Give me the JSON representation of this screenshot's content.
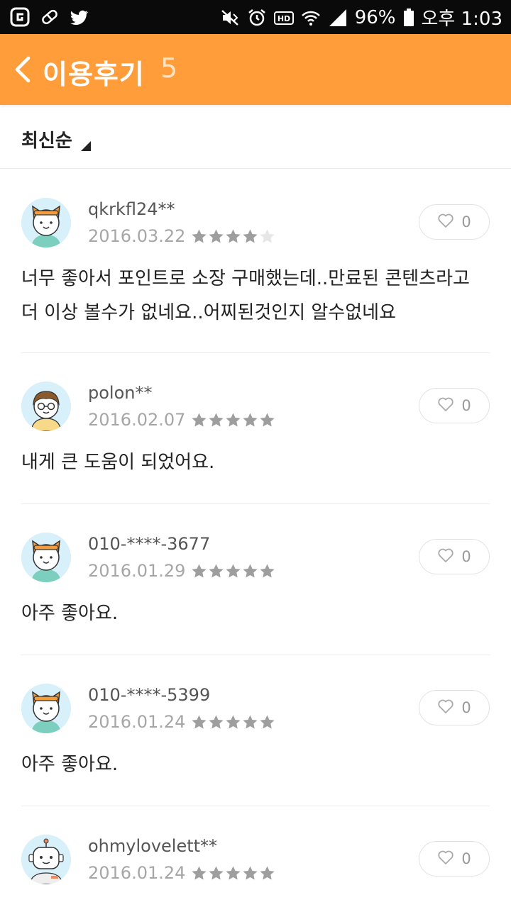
{
  "status_bar": {
    "battery": "96%",
    "time": "오후 1:03",
    "icons": [
      "g-icon",
      "pill-icon",
      "twitter-icon",
      "mute-icon",
      "alarm-icon",
      "hd-icon",
      "wifi-icon",
      "signal-icon",
      "battery-icon"
    ]
  },
  "header": {
    "title": "이용후기",
    "count": "5",
    "back_icon": "chevron-left-icon",
    "background": "#ff9d3a"
  },
  "sort": {
    "label": "최신순"
  },
  "reviews": [
    {
      "nickname": "qkrkfl24**",
      "date": "2016.03.22",
      "rating": 4,
      "likes": "0",
      "text": "너무 좋아서 포인트로 소장 구매했는데..만료된 콘텐츠라고 더 이상 볼수가 없네요..어찌된것인지 알수없네요",
      "avatar": "cat"
    },
    {
      "nickname": "polon**",
      "date": "2016.02.07",
      "rating": 5,
      "likes": "0",
      "text": "내게 큰 도움이 되었어요.",
      "avatar": "boy-glasses"
    },
    {
      "nickname": "010-****-3677",
      "date": "2016.01.29",
      "rating": 5,
      "likes": "0",
      "text": "아주 좋아요.",
      "avatar": "cat"
    },
    {
      "nickname": "010-****-5399",
      "date": "2016.01.24",
      "rating": 5,
      "likes": "0",
      "text": "아주 좋아요.",
      "avatar": "cat"
    },
    {
      "nickname": "ohmylovelett**",
      "date": "2016.01.24",
      "rating": 5,
      "likes": "0",
      "text": "",
      "avatar": "robot"
    }
  ],
  "colors": {
    "accent": "#ff9d3a",
    "star_filled": "#9e9e9e",
    "star_empty": "#e6e6e6"
  }
}
